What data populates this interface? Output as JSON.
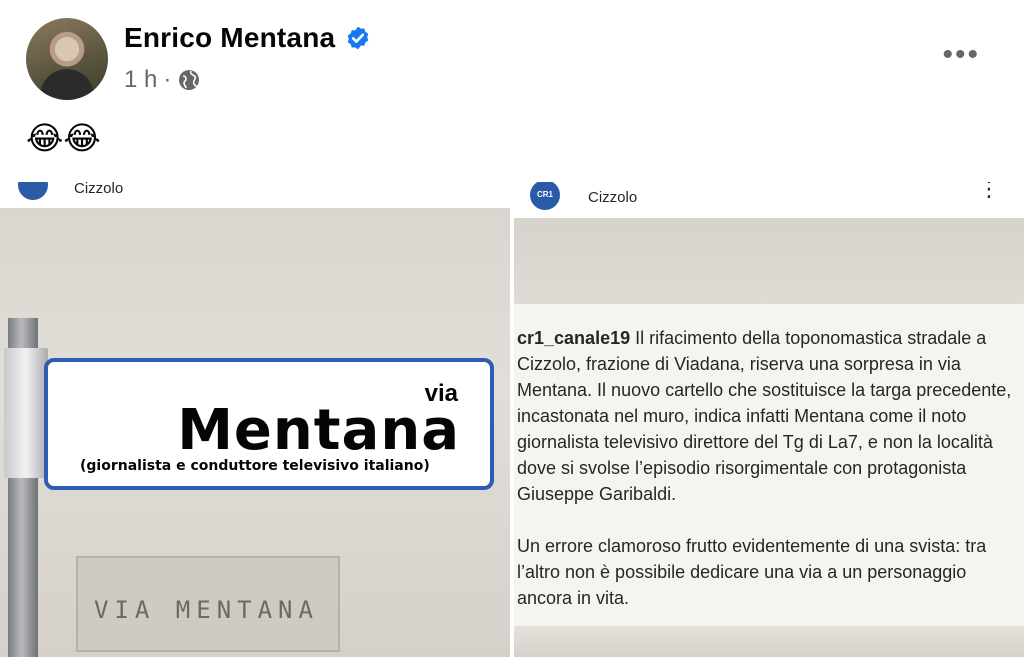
{
  "post": {
    "author": "Enrico Mentana",
    "time": "1 h",
    "separator": "·",
    "emojis": "😂😂"
  },
  "photo_left": {
    "location": "Cizzolo",
    "sign_via": "via",
    "sign_name": "Mentana",
    "sign_subtitle": "(giornalista e conduttore televisivo italiano)",
    "old_plate": "VIA MENTANA"
  },
  "photo_right": {
    "logo_text": "CR1",
    "location": "Cizzolo",
    "username": "cr1_canale19",
    "caption_1": "Il rifacimento della toponomastica stradale a Cizzolo, frazione di Viadana, riserva una sorpresa in via Mentana. Il nuovo cartello che sostituisce la targa precedente, incastonata nel muro, indica infatti Mentana come il noto giornalista televisivo direttore del Tg di La7, e non la località dove si svolse l’episodio risorgimentale con protagonista Giuseppe Garibaldi.",
    "caption_2": "Un errore clamoroso frutto evidentemente di una svista: tra l’altro non è possibile dedicare una via a un personaggio ancora in vita."
  },
  "icons": {
    "verified": "verified-badge-icon",
    "globe": "globe-icon",
    "more": "more-options-icon"
  },
  "colors": {
    "verified_blue": "#1877f2",
    "sign_blue": "#2e5cb3",
    "meta_gray": "#65676b"
  }
}
